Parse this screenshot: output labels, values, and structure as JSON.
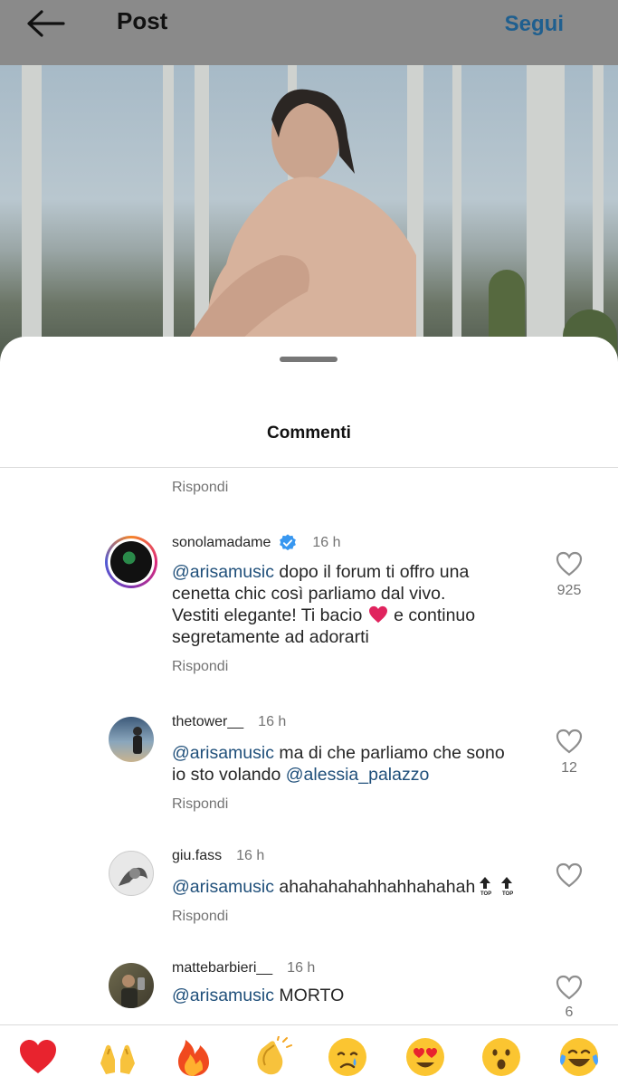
{
  "topbar": {
    "back_icon": "arrow-left-icon",
    "title": "Post",
    "follow_label": "Segui"
  },
  "sheet": {
    "title": "Commenti",
    "first_reply_label": "Rispondi"
  },
  "comments": [
    {
      "username": "sonolamadame",
      "verified": true,
      "time": "16 h",
      "mention": "@arisamusic",
      "text_line1": " dopo il forum ti offro una",
      "text_line2": "cenetta chic così parliamo dal vivo.",
      "text_line3a": "Vestiti elegante! Ti bacio ",
      "text_line3b": " e continuo",
      "text_line4": "segretamente ad adorarti",
      "likes": "925",
      "reply_label": "Rispondi"
    },
    {
      "username": "thetower__",
      "time": "16 h",
      "mention": "@arisamusic",
      "text_line1": " ma di che parliamo che sono",
      "text_line2a": "io sto volando ",
      "mention2": "@alessia_palazzo",
      "likes": "12",
      "reply_label": "Rispondi"
    },
    {
      "username": "giu.fass",
      "time": "16 h",
      "mention": "@arisamusic",
      "text_line1": " ahahahahahhahhahahah",
      "reply_label": "Rispondi"
    },
    {
      "username": "mattebarbieri__",
      "time": "16 h",
      "mention": "@arisamusic",
      "text_line1": " MORTO",
      "likes": "6"
    }
  ],
  "emoji_bar": [
    "❤️",
    "🙌",
    "🔥",
    "👏",
    "😢",
    "😍",
    "😮",
    "😂"
  ],
  "colors": {
    "mention": "#1f4f7a",
    "follow": "#1f5f8f",
    "heart": "#e0245e",
    "verified": "#3897f0"
  }
}
